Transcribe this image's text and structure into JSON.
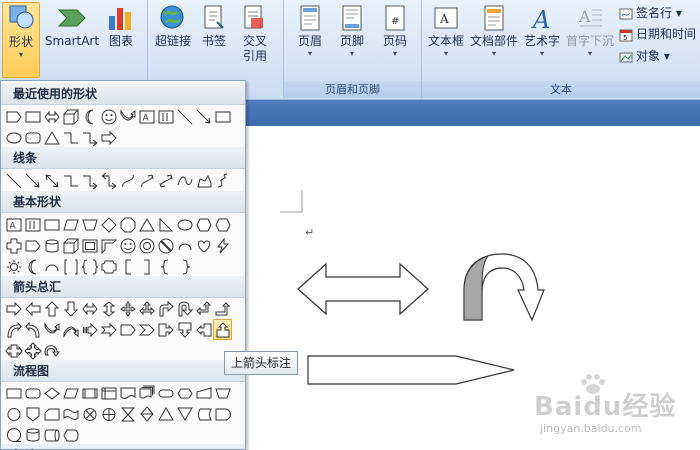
{
  "ribbon": {
    "shapes_label": "形状",
    "smartart_label": "SmartArt",
    "chart_label": "图表",
    "hyperlink_label": "超链接",
    "bookmark_label": "书签",
    "crossref_label_1": "交叉",
    "crossref_label_2": "引用",
    "header_label": "页眉",
    "footer_label": "页脚",
    "pagenum_label": "页码",
    "header_footer_group": "页眉和页脚",
    "textbox_label": "文本框",
    "docparts_label": "文档部件",
    "wordart_label": "艺术字",
    "dropcap_label": "首字下沉",
    "signature_label": "签名行",
    "datetime_label": "日期和时间",
    "object_label": "对象",
    "text_group": "文本"
  },
  "panel": {
    "sections": [
      {
        "title": "最近使用的形状"
      },
      {
        "title": "线条"
      },
      {
        "title": "基本形状"
      },
      {
        "title": "箭头总汇"
      },
      {
        "title": "流程图"
      },
      {
        "title": "标注"
      }
    ]
  },
  "tooltip": {
    "text": "上箭头标注"
  },
  "document": {
    "paragraph_mark": "↵"
  },
  "watermark": {
    "brand": "Baidu经验",
    "url": "jingyan.baidu.com"
  },
  "colors": {
    "ribbon_bg": "#d8e6f7",
    "hover": "#ffd873",
    "accent_band": "#3a6aad"
  }
}
